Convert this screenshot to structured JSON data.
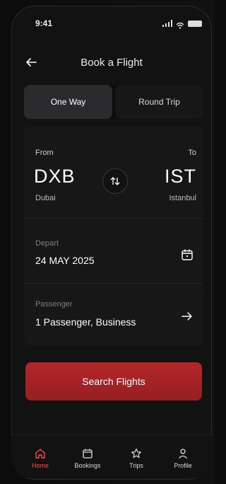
{
  "status_bar": {
    "time": "9:41"
  },
  "header": {
    "title": "Book a Flight"
  },
  "trip_type": {
    "one_way": "One Way",
    "round_trip": "Round Trip"
  },
  "route": {
    "from_label": "From",
    "to_label": "To",
    "from_code": "DXB",
    "to_code": "IST",
    "from_city": "Dubai",
    "to_city": "Istanbul"
  },
  "depart": {
    "label": "Depart",
    "value": "24 MAY 2025"
  },
  "passenger": {
    "label": "Passenger",
    "value": "1 Passenger, Business"
  },
  "cta": {
    "label": "Search Flights"
  },
  "bottom_nav": {
    "items": [
      {
        "label": "Home"
      },
      {
        "label": "Bookings"
      },
      {
        "label": "Trips"
      },
      {
        "label": "Profile"
      }
    ]
  },
  "colors": {
    "accent": "#b3262a",
    "active_nav": "#ff4a4a",
    "background": "#121213"
  }
}
